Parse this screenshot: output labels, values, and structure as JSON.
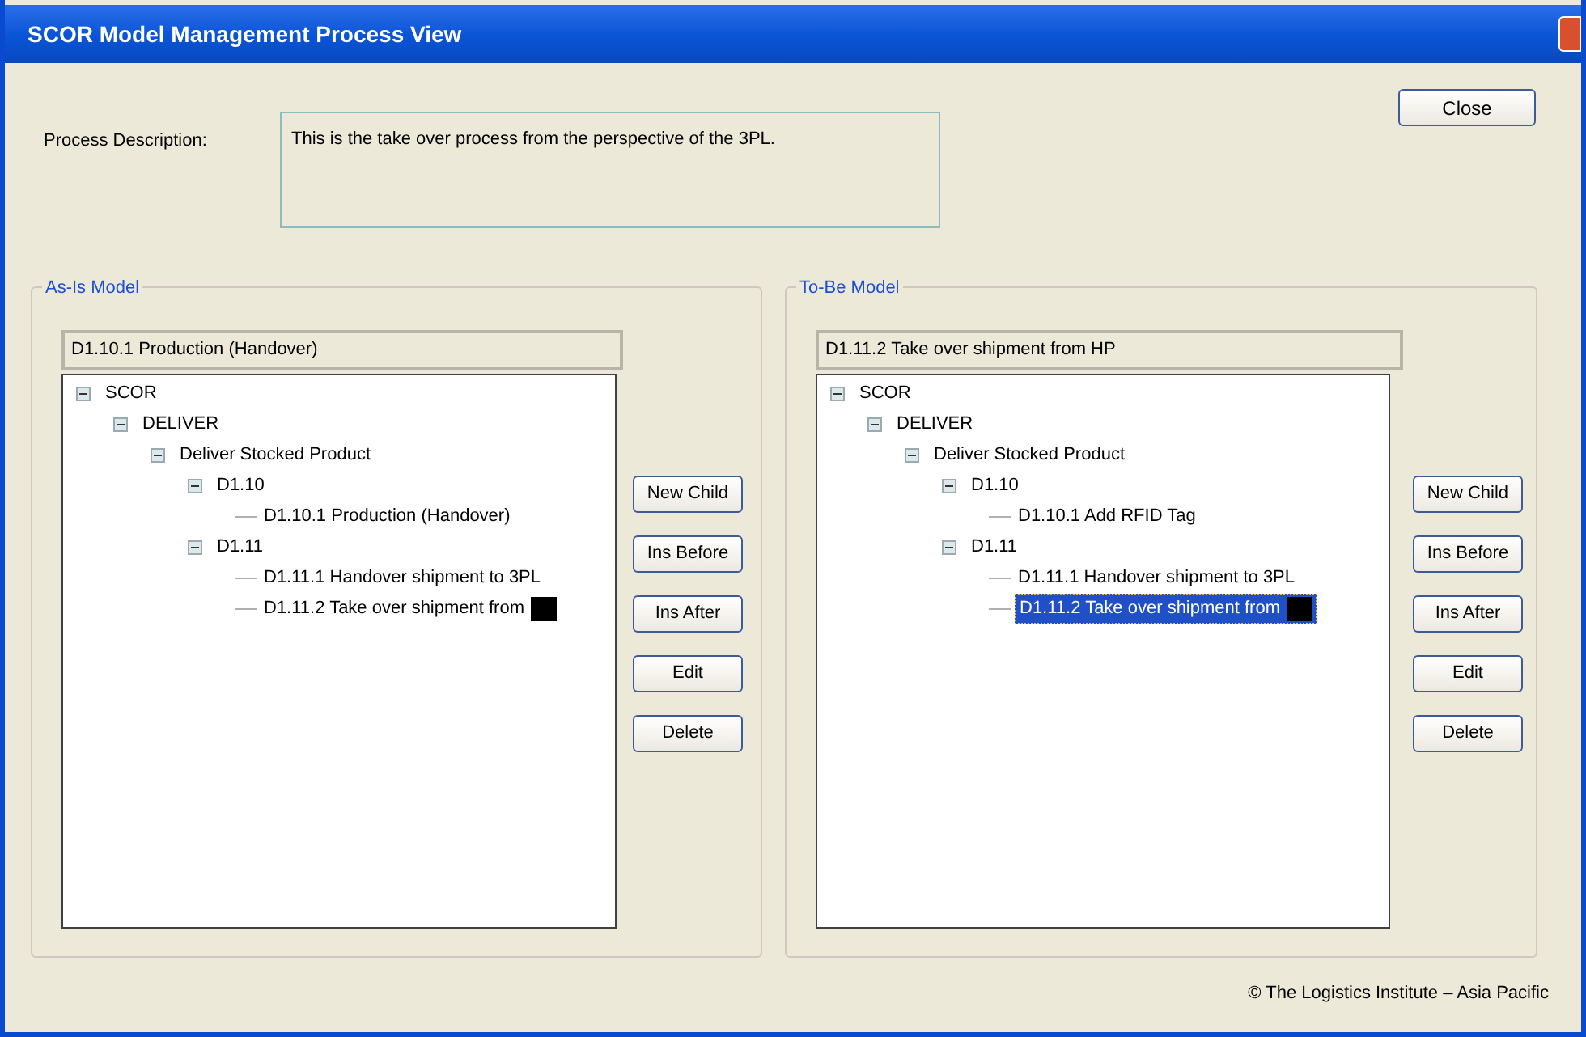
{
  "window": {
    "title": "SCOR Model Management Process View"
  },
  "close_button": "Close",
  "description": {
    "label": "Process Description:",
    "value": "This is the take over process from the perspective of the 3PL."
  },
  "models": [
    {
      "title": "As-Is Model",
      "current": "D1.10.1 Production (Handover)",
      "tree": [
        {
          "label": "SCOR",
          "expanded": true,
          "selected": false,
          "children": [
            {
              "label": "DELIVER",
              "expanded": true,
              "selected": false,
              "children": [
                {
                  "label": "Deliver Stocked Product",
                  "expanded": true,
                  "selected": false,
                  "children": [
                    {
                      "label": "D1.10",
                      "expanded": true,
                      "selected": false,
                      "children": [
                        {
                          "label": "D1.10.1 Production (Handover)",
                          "selected": false,
                          "redacted": false
                        }
                      ]
                    },
                    {
                      "label": "D1.11",
                      "expanded": true,
                      "selected": false,
                      "children": [
                        {
                          "label": "D1.11.1 Handover shipment to 3PL",
                          "selected": false,
                          "redacted": false
                        },
                        {
                          "label": "D1.11.2 Take over shipment from",
                          "selected": false,
                          "redacted": true
                        }
                      ]
                    }
                  ]
                }
              ]
            }
          ]
        }
      ],
      "buttons": [
        "New Child",
        "Ins Before",
        "Ins After",
        "Edit",
        "Delete"
      ]
    },
    {
      "title": "To-Be Model",
      "current": "D1.11.2 Take over shipment from HP",
      "tree": [
        {
          "label": "SCOR",
          "expanded": true,
          "selected": false,
          "children": [
            {
              "label": "DELIVER",
              "expanded": true,
              "selected": false,
              "children": [
                {
                  "label": "Deliver Stocked Product",
                  "expanded": true,
                  "selected": false,
                  "children": [
                    {
                      "label": "D1.10",
                      "expanded": true,
                      "selected": false,
                      "children": [
                        {
                          "label": "D1.10.1 Add RFID Tag",
                          "selected": false,
                          "redacted": false
                        }
                      ]
                    },
                    {
                      "label": "D1.11",
                      "expanded": true,
                      "selected": false,
                      "children": [
                        {
                          "label": "D1.11.1 Handover shipment to 3PL",
                          "selected": false,
                          "redacted": false
                        },
                        {
                          "label": "D1.11.2 Take over shipment from",
                          "selected": true,
                          "redacted": true
                        }
                      ]
                    }
                  ]
                }
              ]
            }
          ]
        }
      ],
      "buttons": [
        "New Child",
        "Ins Before",
        "Ins After",
        "Edit",
        "Delete"
      ]
    }
  ],
  "footer": "© The Logistics Institute – Asia Pacific"
}
